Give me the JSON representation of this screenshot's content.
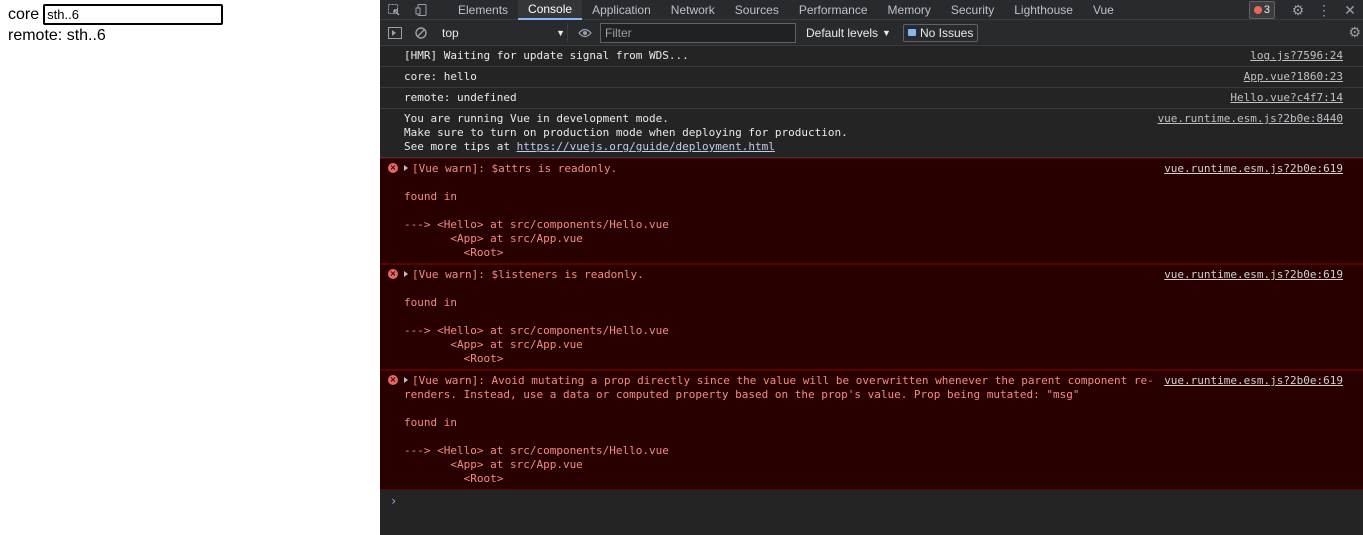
{
  "page": {
    "core_label": "core",
    "core_value": "sth..6",
    "remote_label": "remote: sth..6"
  },
  "devtools": {
    "tabs": [
      "Elements",
      "Console",
      "Application",
      "Network",
      "Sources",
      "Performance",
      "Memory",
      "Security",
      "Lighthouse",
      "Vue"
    ],
    "active_tab": "Console",
    "error_count": "3",
    "context": "top",
    "filter_placeholder": "Filter",
    "levels": "Default levels",
    "issues": "No Issues",
    "messages": [
      {
        "type": "log",
        "text": "[HMR] Waiting for update signal from WDS...",
        "source": "log.js?7596:24"
      },
      {
        "type": "log",
        "text": "core: hello",
        "source": "App.vue?1860:23"
      },
      {
        "type": "log",
        "text": "remote: undefined",
        "source": "Hello.vue?c4f7:14"
      },
      {
        "type": "log",
        "text": "You are running Vue in development mode.\nMake sure to turn on production mode when deploying for production.\nSee more tips at ",
        "link": "https://vuejs.org/guide/deployment.html",
        "source": "vue.runtime.esm.js?2b0e:8440"
      },
      {
        "type": "error",
        "text": "[Vue warn]: $attrs is readonly.\n\nfound in\n\n---> <Hello> at src/components/Hello.vue\n       <App> at src/App.vue\n         <Root>",
        "source": "vue.runtime.esm.js?2b0e:619"
      },
      {
        "type": "error",
        "text": "[Vue warn]: $listeners is readonly.\n\nfound in\n\n---> <Hello> at src/components/Hello.vue\n       <App> at src/App.vue\n         <Root>",
        "source": "vue.runtime.esm.js?2b0e:619"
      },
      {
        "type": "error",
        "text": "[Vue warn]: Avoid mutating a prop directly since the value will be overwritten whenever the parent component re-\nrenders. Instead, use a data or computed property based on the prop's value. Prop being mutated: \"msg\"\n\nfound in\n\n---> <Hello> at src/components/Hello.vue\n       <App> at src/App.vue\n         <Root>",
        "source": "vue.runtime.esm.js?2b0e:619"
      }
    ],
    "prompt_symbol": "›"
  },
  "colors": {
    "error_bg": "#290000",
    "error_text": "#f28b82",
    "accent": "#8ab4f8"
  }
}
